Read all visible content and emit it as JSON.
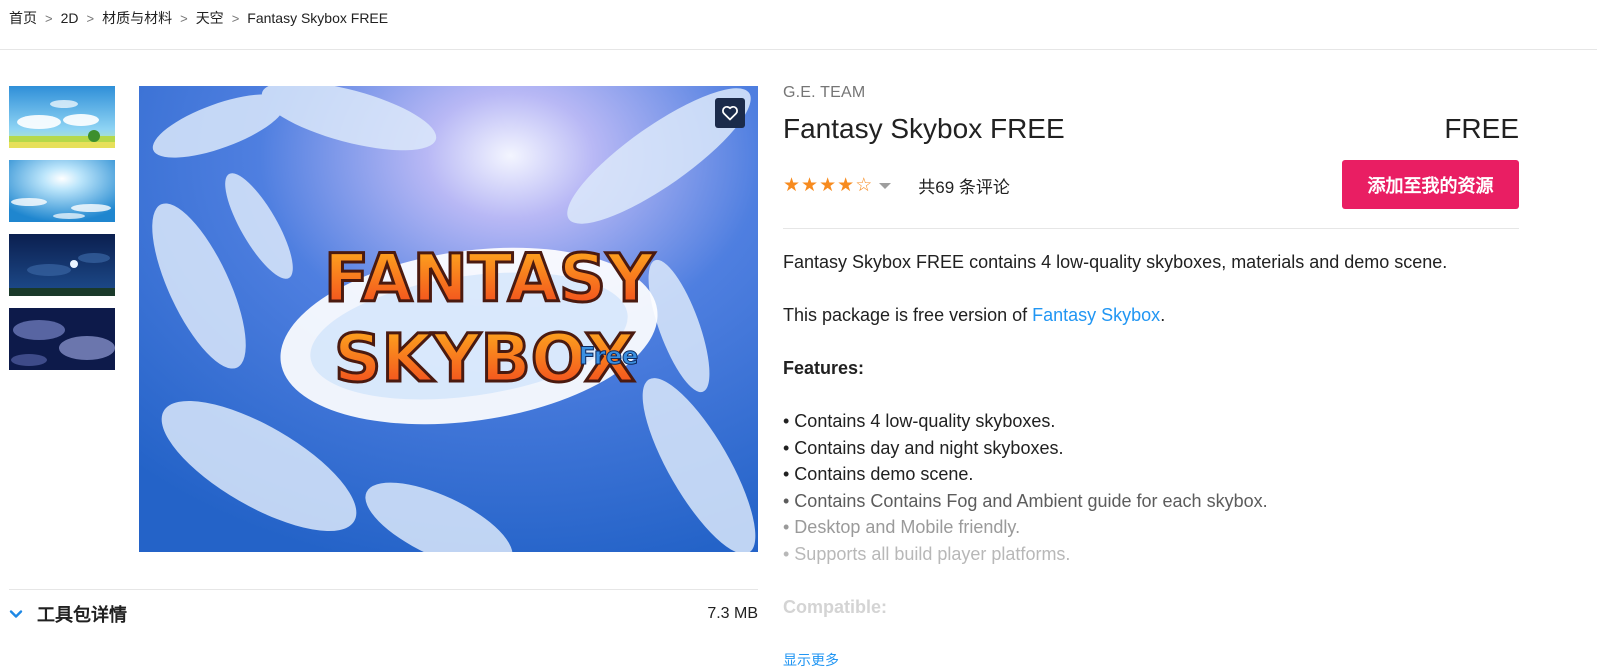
{
  "breadcrumb": [
    "首页",
    "2D",
    "材质与材料",
    "天空",
    "Fantasy Skybox FREE"
  ],
  "breadcrumb_separator": ">",
  "product": {
    "publisher": "G.E. TEAM",
    "title": "Fantasy Skybox FREE",
    "price": "FREE",
    "rating": 4,
    "rating_max": 5,
    "review_count": "共69 条评论",
    "add_button": "添加至我的资源",
    "hero_logo_line1": "FANTASY",
    "hero_logo_line2": "SKYBOX",
    "hero_logo_badge": "Free"
  },
  "description": {
    "intro": "Fantasy Skybox FREE contains 4 low-quality skyboxes, materials and demo scene.",
    "free_prefix": "This package is free version of ",
    "free_link": "Fantasy Skybox",
    "free_suffix": ".",
    "features_heading": "Features:",
    "features": [
      "• Contains 4 low-quality skyboxes.",
      "• Contains day and night skyboxes.",
      "• Contains demo scene.",
      "• Contains Contains Fog and Ambient guide for each skybox.",
      "• Desktop and Mobile friendly.",
      "• Supports all build player platforms."
    ],
    "compatible_heading": "Compatible:",
    "show_more": "显示更多"
  },
  "package_details": {
    "label": "工具包详情",
    "size": "7.3 MB"
  },
  "icons": {
    "favorite": "heart-outline-icon",
    "expand": "chevron-down-icon",
    "rating_dropdown": "caret-down-icon"
  },
  "colors": {
    "accent_button": "#e91e63",
    "link": "#2196f3",
    "star": "#f78b1f",
    "favorite_bg": "#1b2b4b"
  }
}
